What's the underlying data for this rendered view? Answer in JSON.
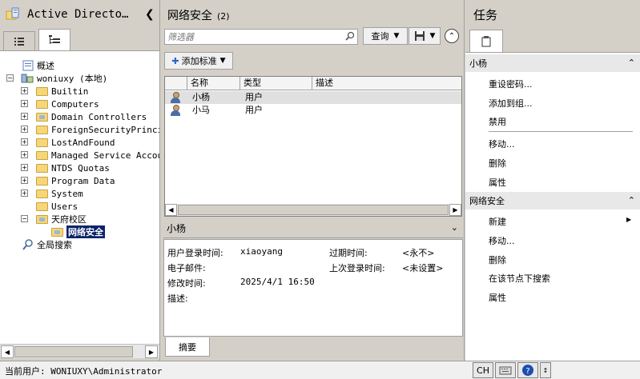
{
  "app": {
    "title": "Active Directo…"
  },
  "left_tabs": [
    {
      "name": "list-view-tab"
    },
    {
      "name": "tree-view-tab"
    }
  ],
  "tree": {
    "overview": "概述",
    "domain": "woniuxy (本地)",
    "containers": [
      "Builtin",
      "Computers",
      "Domain Controllers",
      "ForeignSecurityPrincip",
      "LostAndFound",
      "Managed Service Accour",
      "NTDS Quotas",
      "Program Data",
      "System",
      "Users"
    ],
    "ou": "天府校区",
    "selected_ou": "网络安全",
    "global_search": "全局搜索"
  },
  "middle": {
    "title": "网络安全",
    "count": "(2)",
    "filter_placeholder": "筛选器",
    "query_label": "查询",
    "add_criteria_label": "添加标准",
    "columns": [
      "名称",
      "类型",
      "描述"
    ],
    "rows": [
      {
        "name": "小杨",
        "type": "用户",
        "desc": "",
        "selected": true
      },
      {
        "name": "小马",
        "type": "用户",
        "desc": "",
        "selected": false
      }
    ]
  },
  "detail": {
    "title": "小杨",
    "fields": {
      "logon_label": "用户登录时间:",
      "logon_value": "xiaoyang",
      "expire_label": "过期时间:",
      "expire_value": "<永不>",
      "email_label": "电子邮件:",
      "email_value": "",
      "lastlogon_label": "上次登录时间:",
      "lastlogon_value": "<未设置>",
      "modified_label": "修改时间:",
      "modified_value": "2025/4/1 16:50",
      "desc_label": "描述:",
      "desc_value": ""
    },
    "tab_label": "摘要"
  },
  "tasks": {
    "title": "任务",
    "section1": {
      "title": "小杨",
      "items": [
        "重设密码...",
        "添加到组...",
        "禁用",
        "移动...",
        "删除",
        "属性"
      ]
    },
    "section2": {
      "title": "网络安全",
      "items": [
        "新建",
        "移动...",
        "删除",
        "在该节点下搜索",
        "属性"
      ]
    }
  },
  "status": {
    "text": "当前用户: WONIUXY\\Administrator",
    "ime": "CH"
  }
}
